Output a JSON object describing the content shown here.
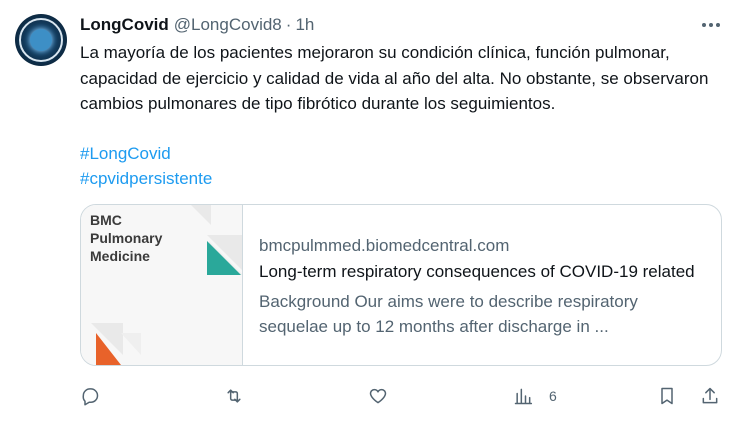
{
  "tweet": {
    "author_name": "LongCovid",
    "handle": "@LongCovid8",
    "separator": "·",
    "time": "1h",
    "text": "La mayoría de los pacientes mejoraron su condición clínica, función pulmonar, capacidad de ejercicio y calidad de vida al año del alta. No obstante, se observaron cambios pulmonares de tipo fibrótico durante los seguimientos.",
    "hashtags": [
      "#LongCovid",
      "#cpvidpersistente"
    ]
  },
  "card": {
    "image_lines": [
      "BMC",
      "Pulmonary",
      "Medicine"
    ],
    "domain": "bmcpulmmed.biomedcentral.com",
    "title": "Long-term respiratory consequences of COVID-19 related",
    "description": "Background Our aims were to describe respiratory sequelae up to 12 months after discharge in ...",
    "accent_colors": {
      "teal": "#2aa89a",
      "orange": "#e8622a"
    }
  },
  "actions": {
    "reply_icon": "reply-icon",
    "retweet_icon": "retweet-icon",
    "like_icon": "heart-icon",
    "views_icon": "bar-chart-icon",
    "views_count": "6",
    "bookmark_icon": "bookmark-icon",
    "share_icon": "share-icon"
  },
  "colors": {
    "link": "#1d9bf0",
    "secondary_text": "#536471",
    "border": "#cfd9de"
  }
}
